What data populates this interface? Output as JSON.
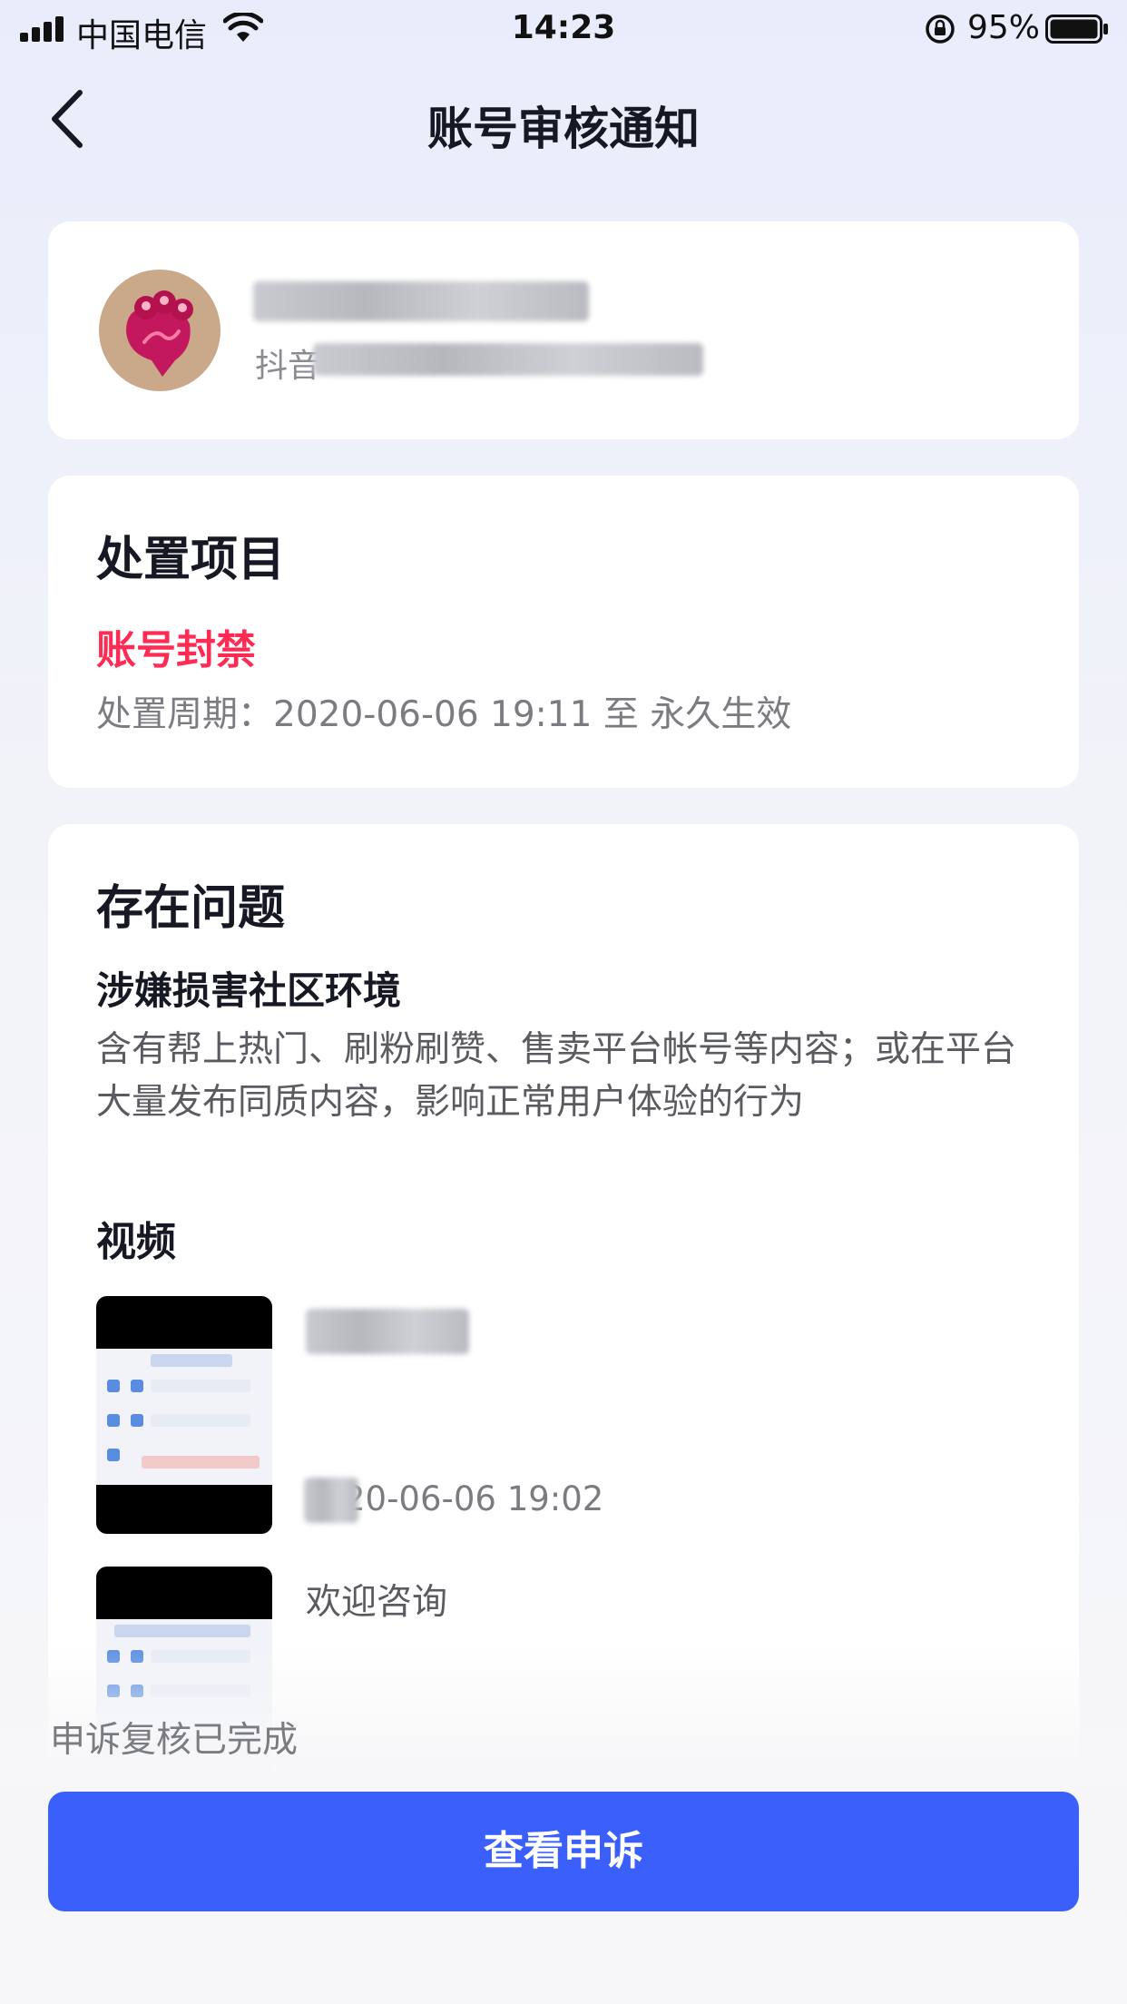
{
  "status_bar": {
    "carrier": "中国电信",
    "time": "14:23",
    "battery_percent": "95%",
    "battery_level": 0.95,
    "icons": [
      "signal-icon",
      "wifi-icon",
      "rotation-lock-icon",
      "battery-icon"
    ]
  },
  "nav": {
    "title": "账号审核通知",
    "back_icon": "chevron-left-icon"
  },
  "profile": {
    "username_visible_prefix": "抖音"
  },
  "disposal": {
    "title": "处置项目",
    "action": "账号封禁",
    "period": "处置周期：2020-06-06 19:11 至 永久生效"
  },
  "issues": {
    "title": "存在问题",
    "issue_name": "涉嫌损害社区环境",
    "issue_description": "含有帮上热门、刷粉刷赞、售卖平台帐号等内容；或在平台大量发布同质内容，影响正常用户体验的行为",
    "videos_label": "视频",
    "videos": [
      {
        "time": "20-06-06 19:02"
      },
      {
        "title": "欢迎咨询"
      }
    ]
  },
  "footer": {
    "review_status": "申诉复核已完成",
    "button_label": "查看申诉"
  },
  "colors": {
    "accent": "#3a5ffa",
    "ban_red": "#fe2c55",
    "text_primary": "#161823",
    "text_secondary": "#7b7c82"
  }
}
